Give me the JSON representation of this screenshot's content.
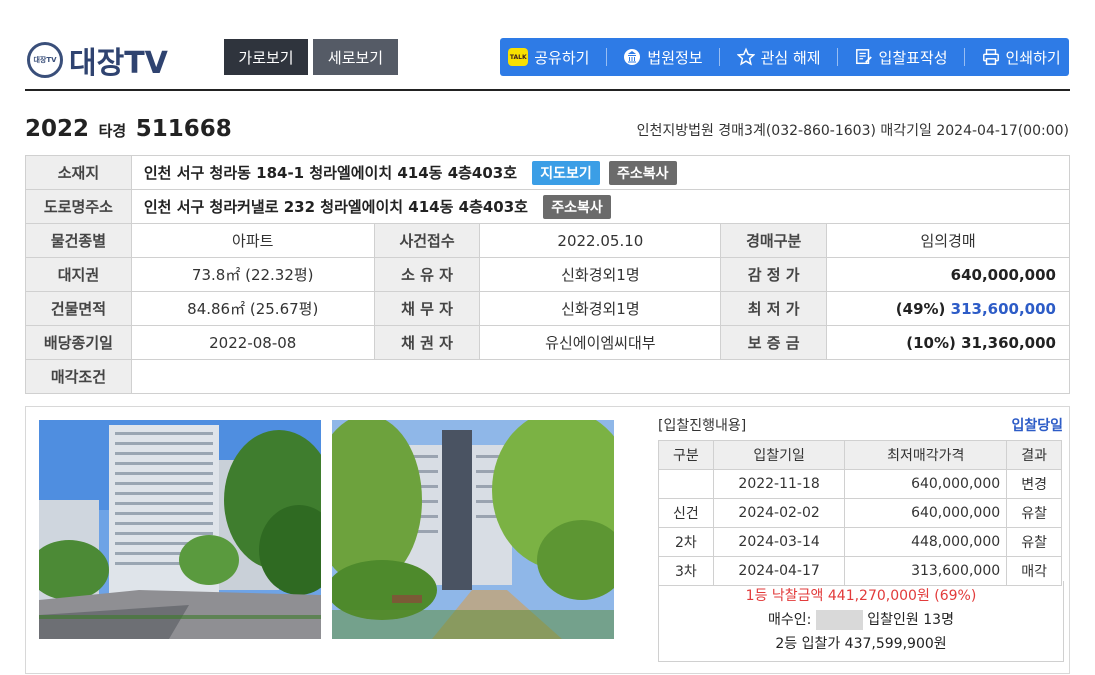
{
  "brand": {
    "logo_badge": "대장TV",
    "logo_text": "대장TV"
  },
  "view_buttons": {
    "horizontal": "가로보기",
    "vertical": "세로보기"
  },
  "toolbar": {
    "share": "공유하기",
    "court_info": "법원정보",
    "unfavorite": "관심 해제",
    "bid_form": "입찰표작성",
    "print": "인쇄하기"
  },
  "case": {
    "year": "2022",
    "type": "타경",
    "number": "511668",
    "court_line": "인천지방법원 경매3계(032-860-1603) 매각기일 2024-04-17(00:00)"
  },
  "info": {
    "location_label": "소재지",
    "location": "인천 서구 청라동 184-1 청라엘에이치 414동 4층403호",
    "map_btn": "지도보기",
    "copy_btn": "주소복사",
    "road_label": "도로명주소",
    "road": "인천 서구 청라커낼로 232 청라엘에이치 414동 4층403호",
    "rows": [
      {
        "l1": "물건종별",
        "v1": "아파트",
        "l2": "사건접수",
        "v2": "2022.05.10",
        "l3": "경매구분",
        "v3": "임의경매"
      },
      {
        "l1": "대지권",
        "v1": "73.8㎡ (22.32평)",
        "l2": "소 유 자",
        "v2": "신화경외1명",
        "l3": "감 정 가",
        "v3": "640,000,000"
      },
      {
        "l1": "건물면적",
        "v1": "84.86㎡ (25.67평)",
        "l2": "채 무 자",
        "v2": "신화경외1명",
        "l3": "최 저 가",
        "v3_pct": "(49%)",
        "v3": "313,600,000"
      },
      {
        "l1": "배당종기일",
        "v1": "2022-08-08",
        "l2": "채 권 자",
        "v2": "유신에이엠씨대부",
        "l3": "보 증 금",
        "v3": "(10%) 31,360,000"
      }
    ],
    "cond_label": "매각조건",
    "cond_value": ""
  },
  "bidding": {
    "title": "[입찰진행내용]",
    "link": "입찰당일",
    "headers": [
      "구분",
      "입찰기일",
      "최저매각가격",
      "결과"
    ],
    "rows": [
      {
        "kind": "",
        "date": "2022-11-18",
        "price": "640,000,000",
        "result": "변경"
      },
      {
        "kind": "신건",
        "date": "2024-02-02",
        "price": "640,000,000",
        "result": "유찰"
      },
      {
        "kind": "2차",
        "date": "2024-03-14",
        "price": "448,000,000",
        "result": "유찰"
      },
      {
        "kind": "3차",
        "date": "2024-04-17",
        "price": "313,600,000",
        "result": "매각"
      }
    ],
    "winning": "1등 낙찰금액 441,270,000원 (69%)",
    "buyer_label": "매수인:",
    "bidders": "입찰인원 13명",
    "second": "2등 입찰가 437,599,900원"
  },
  "colors": {
    "accent": "#2e7be6",
    "brand": "#2f4370",
    "red": "#e23b3b",
    "link": "#2d5cc7"
  },
  "icons": [
    "kakao-icon",
    "court-icon",
    "star-icon",
    "bid-form-icon",
    "printer-icon"
  ]
}
